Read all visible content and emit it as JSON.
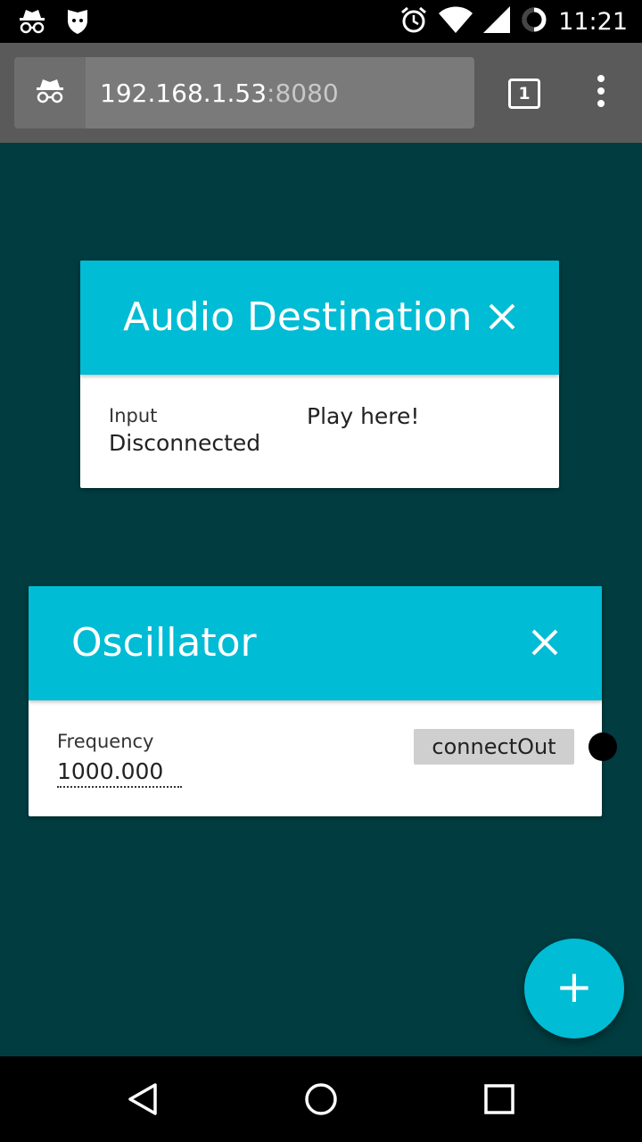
{
  "status_bar": {
    "time": "11:21",
    "left_icons": [
      "incognito-icon",
      "cat-shield-icon"
    ],
    "right_icons": [
      "alarm-icon",
      "wifi-icon",
      "signal-icon",
      "battery-icon"
    ]
  },
  "browser": {
    "url_host": "192.168.1.53",
    "url_port": ":8080",
    "tab_count": "1"
  },
  "audio_destination": {
    "title": "Audio Destination",
    "input_label": "Input",
    "input_value": "Disconnected",
    "play_text": "Play here!"
  },
  "oscillator": {
    "title": "Oscillator",
    "frequency_label": "Frequency",
    "frequency_value": "1000.000",
    "connect_label": "connectOut"
  },
  "fab": {
    "label": "+"
  },
  "colors": {
    "background": "#013d40",
    "accent": "#00bcd4",
    "toolbar": "#5a5a5a"
  }
}
